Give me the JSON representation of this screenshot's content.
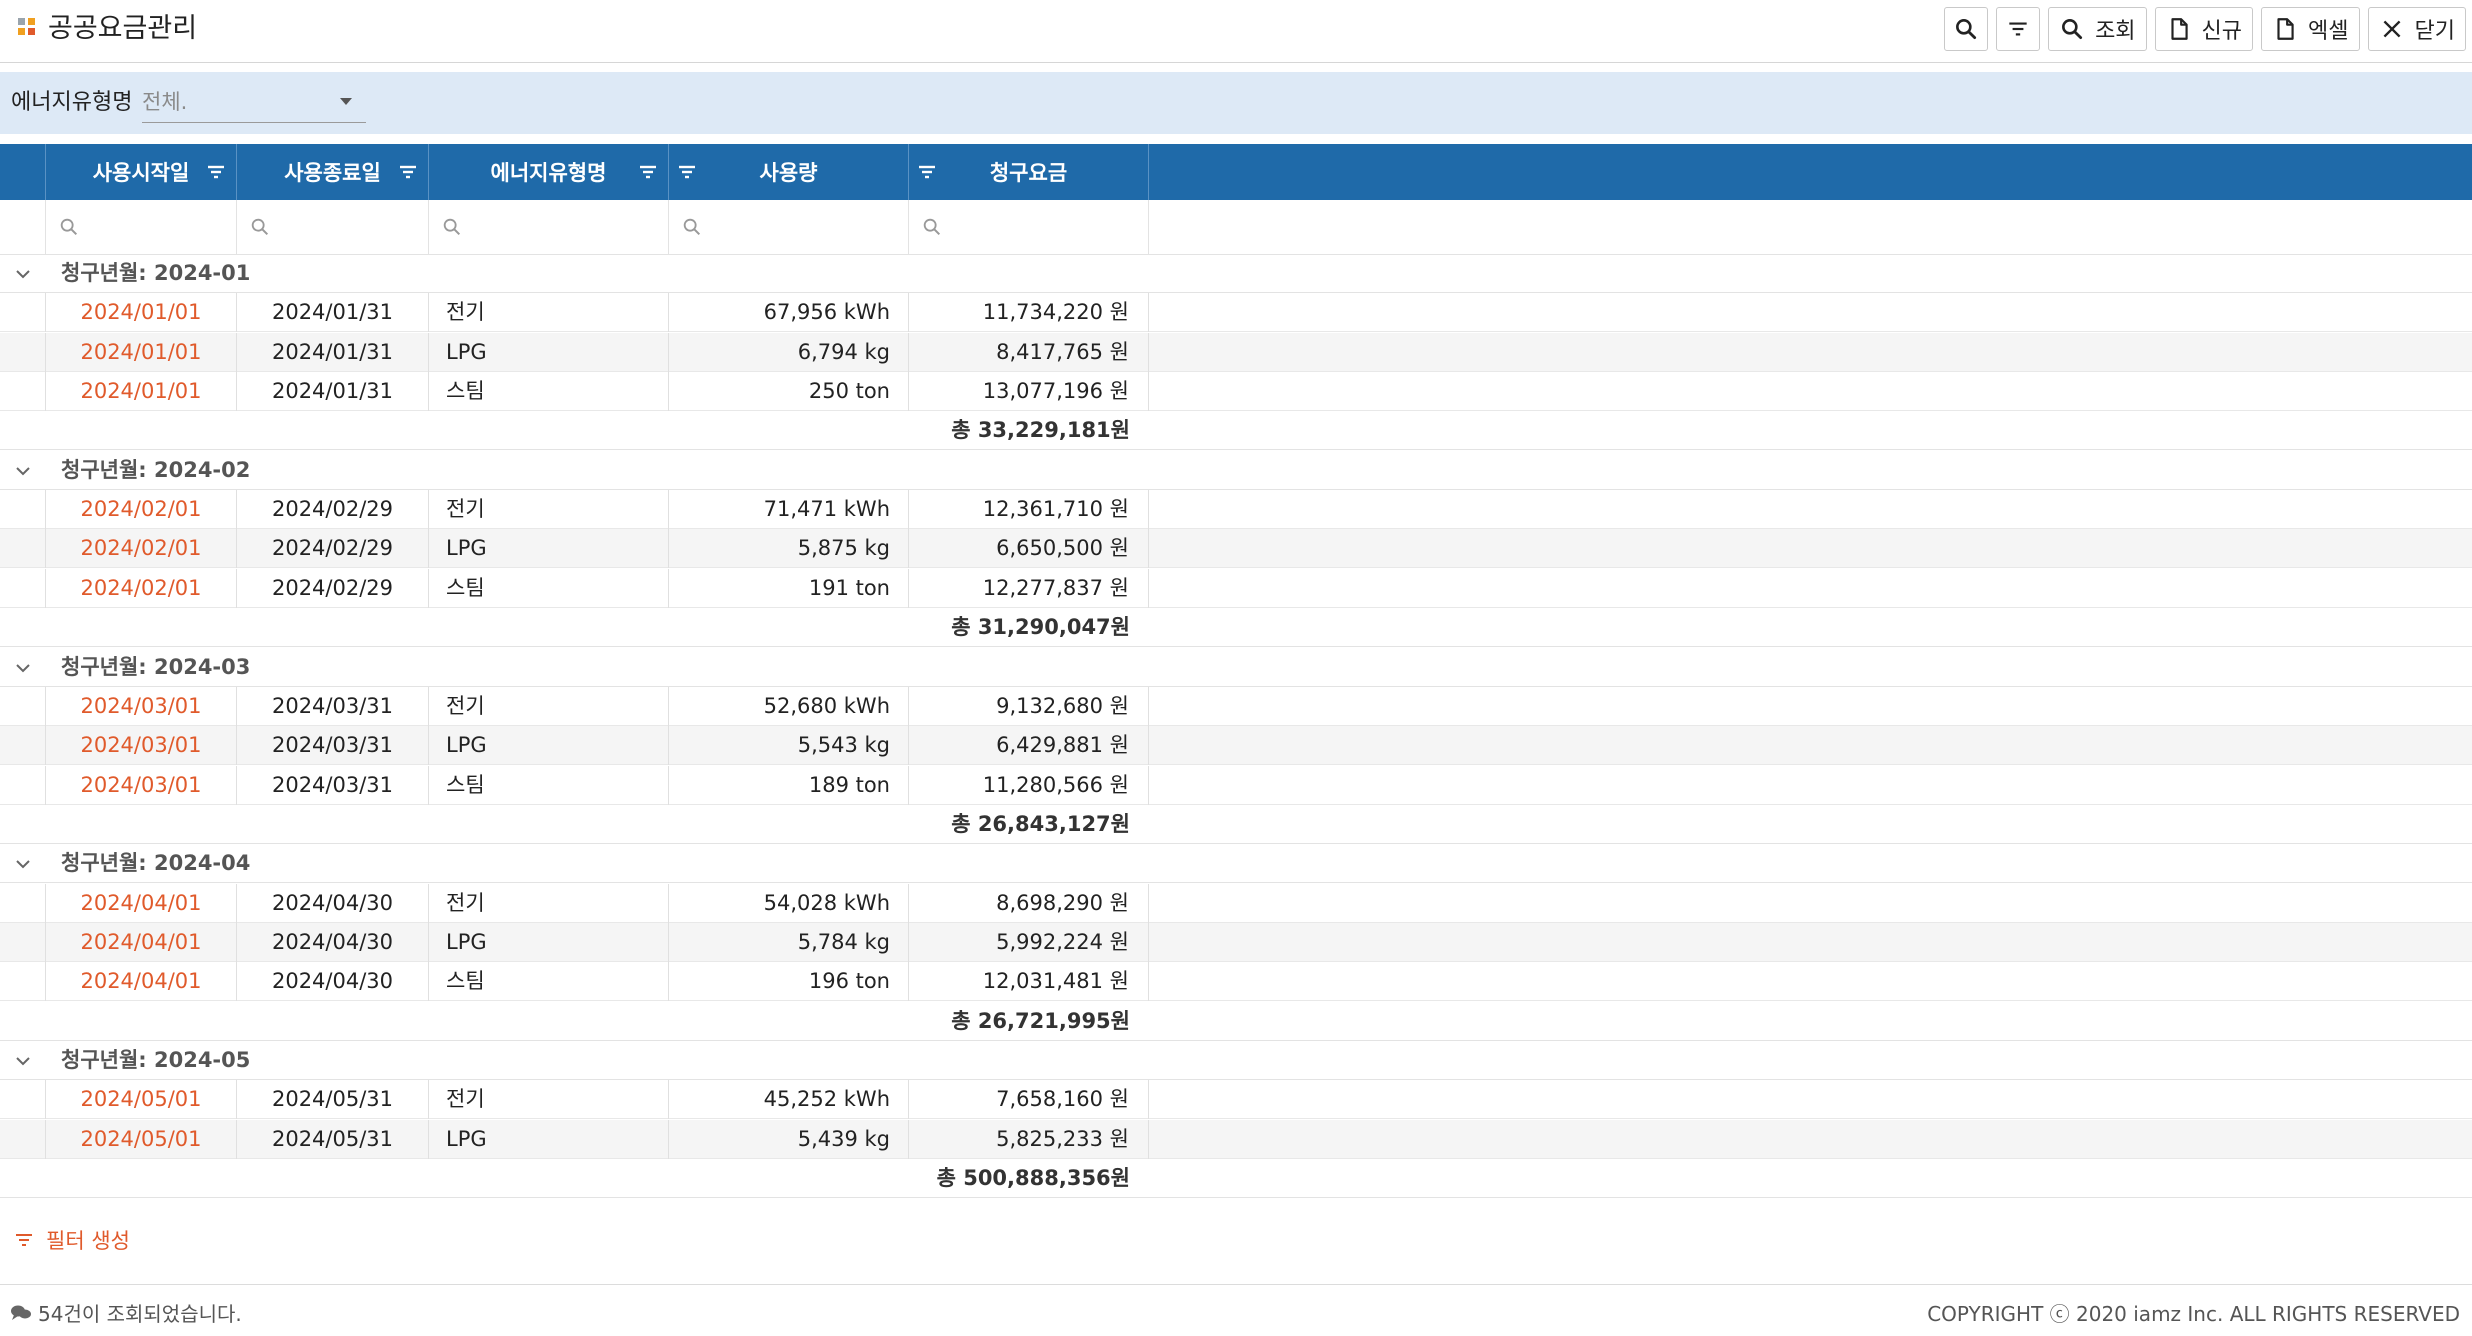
{
  "app": {
    "title": "공공요금관리"
  },
  "toolbar": {
    "search_label": "조회",
    "new_label": "신규",
    "excel_label": "엑셀",
    "close_label": "닫기"
  },
  "filter": {
    "label": "에너지유형명",
    "placeholder": "전체."
  },
  "grid": {
    "columns": [
      "사용시작일",
      "사용종료일",
      "에너지유형명",
      "사용량",
      "청구요금"
    ],
    "groups": [
      {
        "label": "청구년월: 2024-01",
        "rows": [
          {
            "start": "2024/01/01",
            "end": "2024/01/31",
            "type": "전기",
            "usage": "67,956 kWh",
            "fee": "11,734,220 원"
          },
          {
            "start": "2024/01/01",
            "end": "2024/01/31",
            "type": "LPG",
            "usage": "6,794 kg",
            "fee": "8,417,765 원"
          },
          {
            "start": "2024/01/01",
            "end": "2024/01/31",
            "type": "스팀",
            "usage": "250 ton",
            "fee": "13,077,196 원"
          }
        ],
        "total": "총 33,229,181원"
      },
      {
        "label": "청구년월: 2024-02",
        "rows": [
          {
            "start": "2024/02/01",
            "end": "2024/02/29",
            "type": "전기",
            "usage": "71,471 kWh",
            "fee": "12,361,710 원"
          },
          {
            "start": "2024/02/01",
            "end": "2024/02/29",
            "type": "LPG",
            "usage": "5,875 kg",
            "fee": "6,650,500 원"
          },
          {
            "start": "2024/02/01",
            "end": "2024/02/29",
            "type": "스팀",
            "usage": "191 ton",
            "fee": "12,277,837 원"
          }
        ],
        "total": "총 31,290,047원"
      },
      {
        "label": "청구년월: 2024-03",
        "rows": [
          {
            "start": "2024/03/01",
            "end": "2024/03/31",
            "type": "전기",
            "usage": "52,680 kWh",
            "fee": "9,132,680 원"
          },
          {
            "start": "2024/03/01",
            "end": "2024/03/31",
            "type": "LPG",
            "usage": "5,543 kg",
            "fee": "6,429,881 원"
          },
          {
            "start": "2024/03/01",
            "end": "2024/03/31",
            "type": "스팀",
            "usage": "189 ton",
            "fee": "11,280,566 원"
          }
        ],
        "total": "총 26,843,127원"
      },
      {
        "label": "청구년월: 2024-04",
        "rows": [
          {
            "start": "2024/04/01",
            "end": "2024/04/30",
            "type": "전기",
            "usage": "54,028 kWh",
            "fee": "8,698,290 원"
          },
          {
            "start": "2024/04/01",
            "end": "2024/04/30",
            "type": "LPG",
            "usage": "5,784 kg",
            "fee": "5,992,224 원"
          },
          {
            "start": "2024/04/01",
            "end": "2024/04/30",
            "type": "스팀",
            "usage": "196 ton",
            "fee": "12,031,481 원"
          }
        ],
        "total": "총 26,721,995원"
      },
      {
        "label": "청구년월: 2024-05",
        "rows": [
          {
            "start": "2024/05/01",
            "end": "2024/05/31",
            "type": "전기",
            "usage": "45,252 kWh",
            "fee": "7,658,160 원"
          },
          {
            "start": "2024/05/01",
            "end": "2024/05/31",
            "type": "LPG",
            "usage": "5,439 kg",
            "fee": "5,825,233 원"
          }
        ],
        "total": "총 500,888,356원"
      }
    ]
  },
  "create_filter_label": "필터 생성",
  "status": {
    "message": "54건이 조회되었습니다.",
    "copyright": "COPYRIGHT ⓒ 2020 iamz Inc. ALL RIGHTS RESERVED"
  },
  "colors": {
    "header_bg": "#1f6aa9",
    "filter_bg": "#dde9f6",
    "accent_orange": "#e05a2b"
  }
}
